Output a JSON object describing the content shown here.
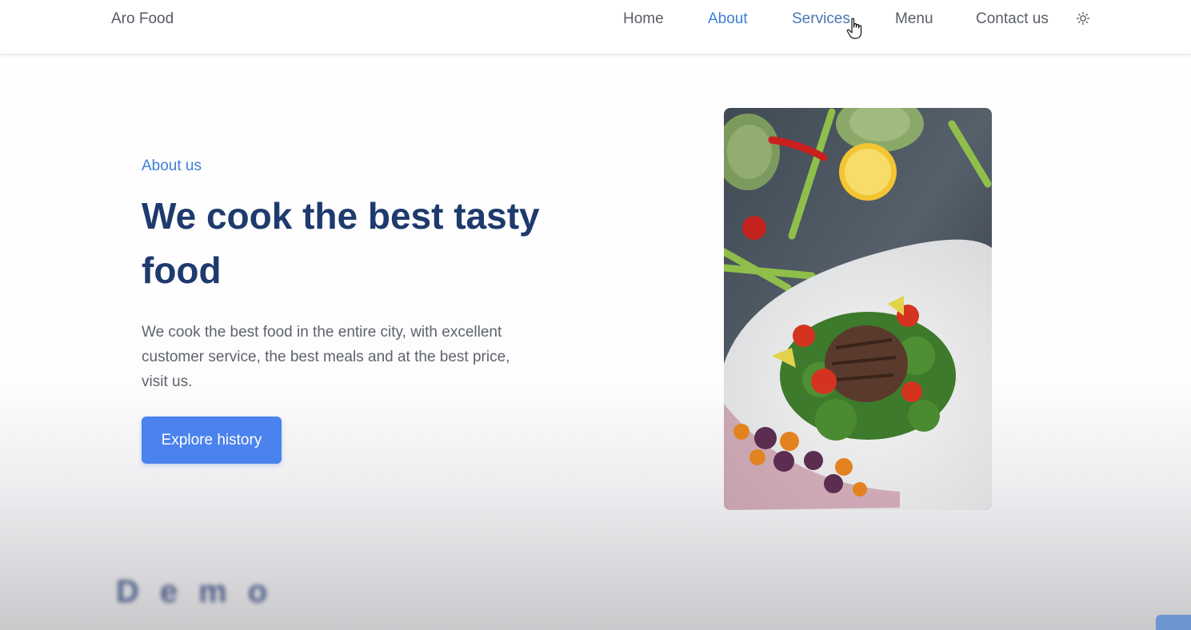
{
  "header": {
    "logo": "Aro Food",
    "nav": [
      {
        "label": "Home",
        "state": "default"
      },
      {
        "label": "About",
        "state": "active"
      },
      {
        "label": "Services",
        "state": "hover"
      },
      {
        "label": "Menu",
        "state": "default"
      },
      {
        "label": "Contact us",
        "state": "default"
      }
    ],
    "theme_icon": "sun-icon"
  },
  "about": {
    "tag": "About us",
    "headline": "We cook the best tasty food",
    "description": "We cook the best food in the entire city, with excellent customer service, the best meals and at the best price, visit us.",
    "button_label": "Explore history"
  },
  "watermark": "Demo",
  "colors": {
    "accent": "#3f7fd6",
    "heading": "#1e3a6e",
    "button": "#4a82ee"
  }
}
